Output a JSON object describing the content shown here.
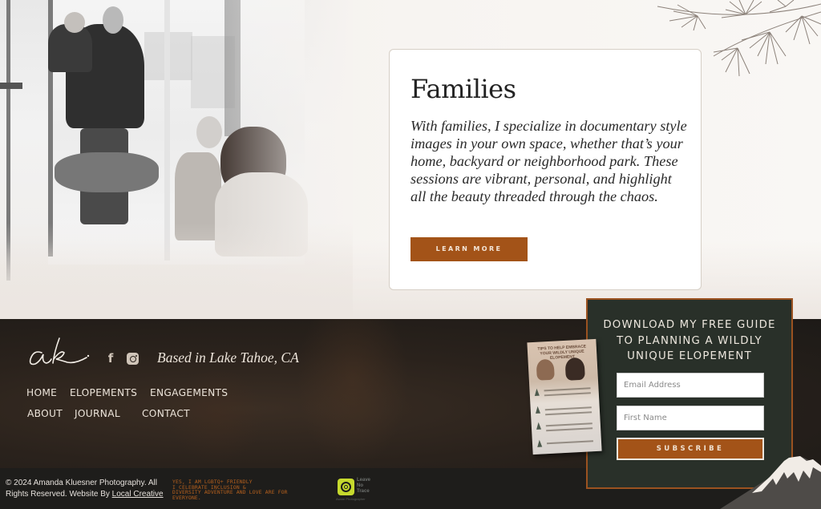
{
  "hero": {
    "image_alt": "family-photo",
    "card": {
      "title": "Families",
      "body": "With families, I specialize in documentary style images in your own space, whether that’s your home, backyard or neighborhood park. These sessions are vibrant, personal, and highlight all the beauty threaded through the chaos.",
      "button_label": "LEARN MORE"
    }
  },
  "footer": {
    "logo_text": "ak",
    "social": [
      {
        "name": "facebook",
        "icon": "facebook-icon",
        "glyph": "f"
      },
      {
        "name": "instagram",
        "icon": "instagram-icon"
      }
    ],
    "location": "Based in Lake Tahoe, CA",
    "nav": [
      {
        "label": "HOME"
      },
      {
        "label": "ELOPEMENTS"
      },
      {
        "label": "ENGAGEMENTS"
      },
      {
        "label": "ABOUT"
      },
      {
        "label": "JOURNAL"
      },
      {
        "label": "CONTACT"
      }
    ],
    "copyright": "© 2024 Amanda Kluesner Photography. All Rights Reserved.",
    "website_by_prefix": "Website By",
    "website_by_link": "Local Creative",
    "lgbt_lines": [
      "YES, I AM LGBTQ+ FRIENDLY",
      "I CELEBRATE INCLUSION &",
      "DIVERSITY ADVENTURE AND LOVE ARE FOR",
      "EVERYONE."
    ],
    "lnt": {
      "line1": "Leave",
      "line2": "No",
      "line3": "Trace",
      "sub": "Aware Photographer"
    }
  },
  "signup": {
    "heading_lines": [
      "DOWNLOAD MY FREE GUIDE",
      "TO PLANNING A WILDLY",
      "UNIQUE ELOPEMENT"
    ],
    "email_placeholder": "Email Address",
    "email_value": "",
    "name_placeholder": "First Name",
    "name_value": "",
    "subscribe_label": "SUBSCRIBE",
    "booklet_title": "TIPS TO HELP EMBRACE YOUR WILDLY UNIQUE ELOPEMENT"
  },
  "colors": {
    "accent": "#a35318",
    "footer_bg": "#1e1d1b",
    "signup_bg": "#293029",
    "lnt_green": "#c6d92d"
  }
}
